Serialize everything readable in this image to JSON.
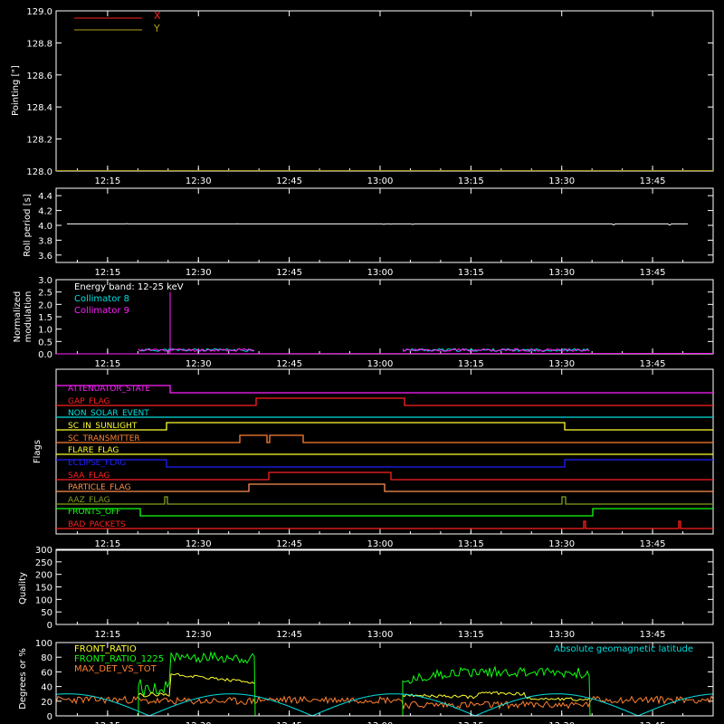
{
  "time_ticks": [
    "12:15",
    "12:30",
    "12:45",
    "13:00",
    "13:15",
    "13:30",
    "13:45"
  ],
  "colors": {
    "white": "#ffffff",
    "red": "#ff2020",
    "olive": "#b0a020",
    "cyan": "#00e0e0",
    "magenta": "#ff20ff",
    "green": "#10ff10",
    "yellow": "#ffff30",
    "orange": "#ff8030",
    "blue": "#2020ff",
    "darkgreen": "#80a020",
    "lightorange": "#ff9050"
  },
  "chart_data": [
    {
      "id": "pointing",
      "type": "line",
      "ylabel": "Pointing [\"]",
      "ylim": [
        128.0,
        129.0
      ],
      "yticks": [
        "129.0",
        "128.8",
        "128.6",
        "128.4",
        "128.2",
        "128.0"
      ],
      "legend": [
        {
          "name": "X",
          "color": "#ff2020"
        },
        {
          "name": "Y",
          "color": "#b0a020"
        }
      ],
      "series": [
        {
          "name": "Y",
          "values_note": "flat",
          "points": [
            [
              0,
              128.0
            ],
            [
              1,
              128.0
            ]
          ],
          "color": "#b0a020"
        }
      ]
    },
    {
      "id": "roll",
      "type": "line",
      "ylabel": "Roll period [s]",
      "ylim": [
        3.5,
        4.5
      ],
      "yticks": [
        "4.4",
        "4.2",
        "4.0",
        "3.8",
        "3.6"
      ],
      "series": [
        {
          "name": "roll",
          "color": "#ffffff",
          "level": 4.02
        }
      ]
    },
    {
      "id": "modulation",
      "type": "line",
      "ylabel": "Normalized modulation",
      "ylim": [
        0.0,
        3.0
      ],
      "yticks": [
        "3.0",
        "2.5",
        "2.0",
        "1.5",
        "1.0",
        "0.5",
        "0.0"
      ],
      "legend": [
        {
          "name": "Energy band: 12-25 keV",
          "color": "#ffffff"
        },
        {
          "name": "Collimator 8",
          "color": "#00e0e0"
        },
        {
          "name": "Collimator 9",
          "color": "#ff20ff"
        }
      ]
    },
    {
      "id": "flags",
      "type": "line",
      "ylabel": "Flags",
      "flags": [
        {
          "name": "ATTENUATOR_STATE",
          "color": "#ff20ff"
        },
        {
          "name": "GAP_FLAG",
          "color": "#ff2020"
        },
        {
          "name": "NON_SOLAR_EVENT",
          "color": "#00e0e0"
        },
        {
          "name": "SC_IN_SUNLIGHT",
          "color": "#ffff30"
        },
        {
          "name": "SC_TRANSMITTER",
          "color": "#ff8030"
        },
        {
          "name": "FLARE_FLAG",
          "color": "#ffff30"
        },
        {
          "name": "ECLIPSE_FLAG",
          "color": "#2020ff"
        },
        {
          "name": "SAA_FLAG",
          "color": "#ff2020"
        },
        {
          "name": "PARTICLE_FLAG",
          "color": "#ff9050"
        },
        {
          "name": "AAZ_FLAG",
          "color": "#80a020"
        },
        {
          "name": "FRONTS_OFF",
          "color": "#10ff10"
        },
        {
          "name": "BAD_PACKETS",
          "color": "#ff2020"
        }
      ]
    },
    {
      "id": "quality",
      "type": "line",
      "ylabel": "Quality",
      "ylim": [
        0,
        300
      ],
      "yticks": [
        "300",
        "250",
        "200",
        "150",
        "100",
        "50",
        "0"
      ]
    },
    {
      "id": "ratios",
      "type": "line",
      "ylabel": "Degrees or %",
      "ylim": [
        0,
        100
      ],
      "yticks": [
        "100",
        "80",
        "60",
        "40",
        "20",
        "0"
      ],
      "legend": [
        {
          "name": "FRONT_RATIO",
          "color": "#ffff30"
        },
        {
          "name": "FRONT_RATIO_1225",
          "color": "#10ff10"
        },
        {
          "name": "MAX_DET_VS_TOT",
          "color": "#ff8030"
        }
      ],
      "annotation": {
        "text": "Absolute geomagnetic latitude",
        "color": "#00e0e0"
      }
    }
  ]
}
